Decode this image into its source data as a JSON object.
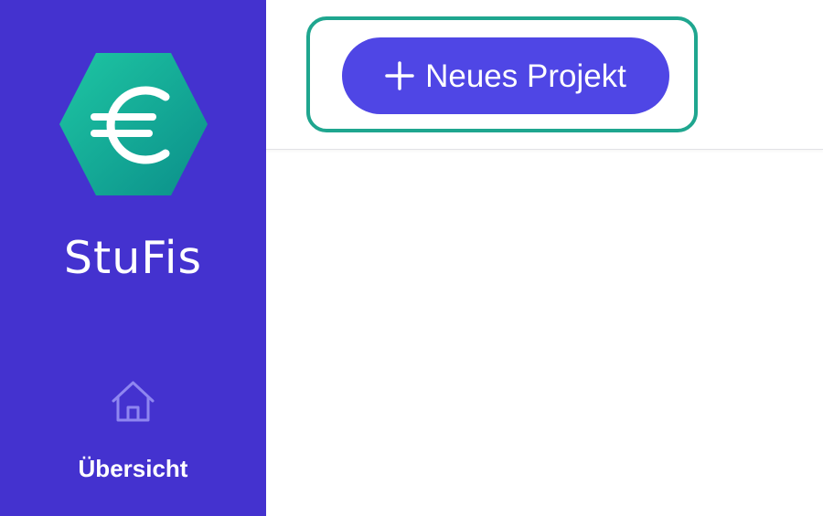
{
  "sidebar": {
    "brand": "StuFis",
    "logo_icon": "euro-hexagon-icon",
    "items": [
      {
        "label": "Übersicht",
        "icon": "home-icon"
      }
    ]
  },
  "header": {
    "new_project_label": "Neues Projekt",
    "new_project_icon": "plus-icon"
  },
  "colors": {
    "sidebar_bg": "#4432cf",
    "button_bg": "#4f46e5",
    "highlight_border": "#1fa68f",
    "logo_teal": "#13b39a"
  }
}
